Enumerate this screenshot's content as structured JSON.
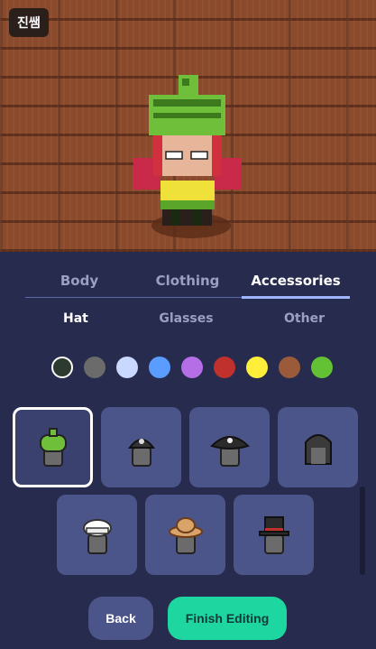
{
  "player": {
    "name": "진쌤"
  },
  "tabs": [
    {
      "label": "Body",
      "active": false
    },
    {
      "label": "Clothing",
      "active": false
    },
    {
      "label": "Accessories",
      "active": true
    }
  ],
  "subtabs": [
    {
      "label": "Hat",
      "active": true
    },
    {
      "label": "Glasses",
      "active": false
    },
    {
      "label": "Other",
      "active": false
    }
  ],
  "colors": [
    "#2d3a30",
    "#6b6b6b",
    "#c8d8ff",
    "#5a9cff",
    "#b66ee6",
    "#c0302c",
    "#ffef3a",
    "#9b5b3a",
    "#63c233"
  ],
  "selected_color_index": 0,
  "hats": [
    {
      "icon": "green-beanie-hat-icon",
      "selected": true
    },
    {
      "icon": "black-cap-hat-icon",
      "selected": false
    },
    {
      "icon": "pirate-hat-icon",
      "selected": false
    },
    {
      "icon": "dark-hood-hat-icon",
      "selected": false
    },
    {
      "icon": "white-chef-hat-icon",
      "selected": false
    },
    {
      "icon": "straw-hat-icon",
      "selected": false
    },
    {
      "icon": "top-hat-icon",
      "selected": false
    }
  ],
  "buttons": {
    "back": "Back",
    "finish": "Finish Editing"
  }
}
